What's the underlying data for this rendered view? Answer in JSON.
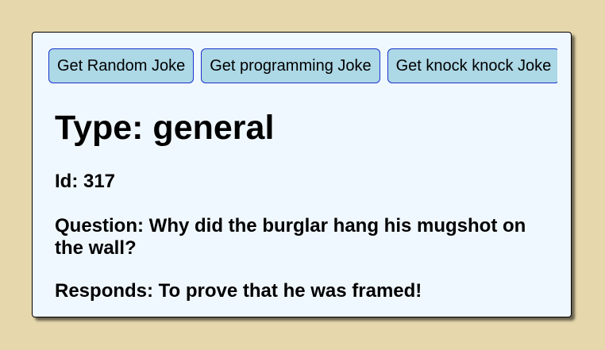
{
  "buttons": {
    "random": "Get Random Joke",
    "programming": "Get programming Joke",
    "knock": "Get knock knock Joke"
  },
  "joke": {
    "type_text": "Type: general",
    "id_text": "Id: 317",
    "question_text": "Question: Why did the burglar hang his mugshot on the wall?",
    "response_text": "Responds: To prove that he was framed!"
  },
  "colors": {
    "page_background": "#e6d8ac",
    "card_background": "#f0f8ff",
    "button_background": "#add8e6",
    "button_border": "#1a33cc"
  }
}
